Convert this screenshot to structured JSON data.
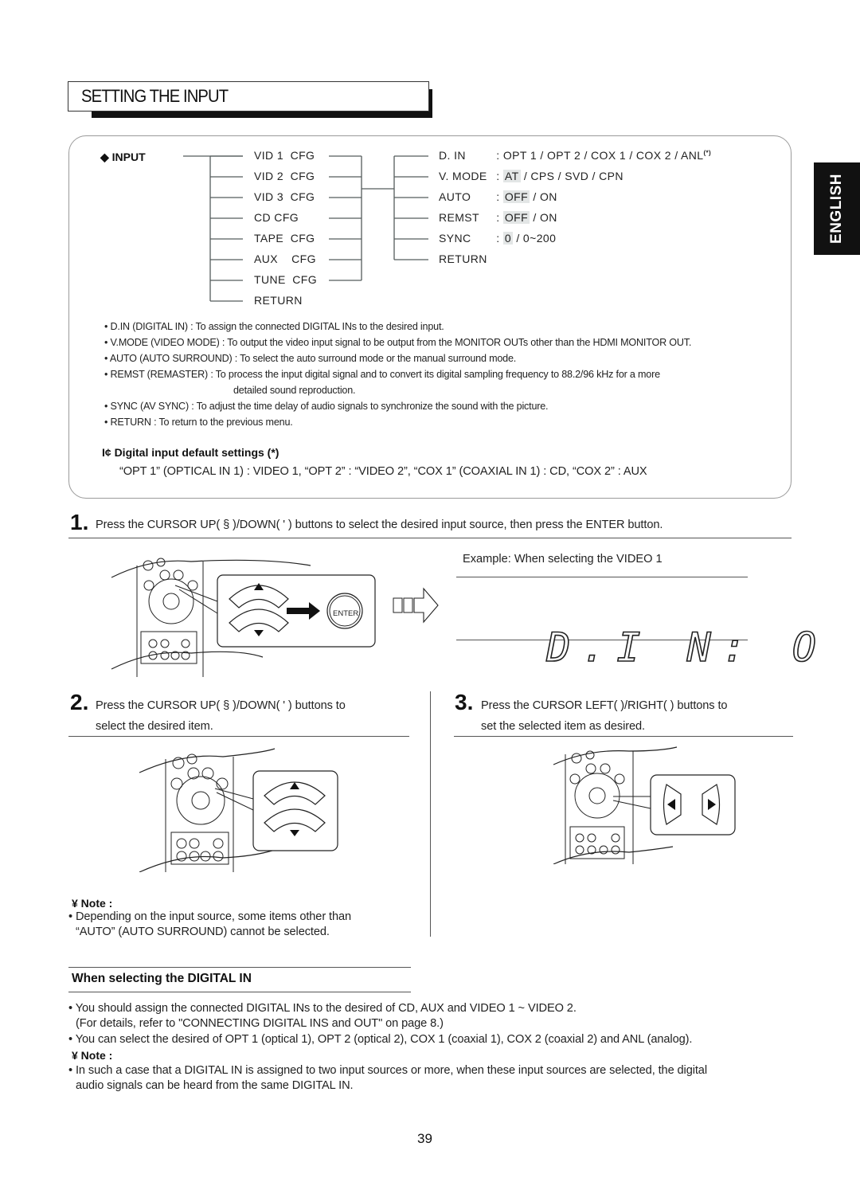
{
  "title": "SETTING THE INPUT",
  "language_tab": "ENGLISH",
  "menu": {
    "root_label": "INPUT",
    "root_bullet": "◆",
    "sub_items": [
      "VID 1  CFG",
      "VID 2  CFG",
      "VID 3  CFG",
      "CD CFG",
      "TAPE  CFG",
      "AUX    CFG",
      "TUNE  CFG",
      "RETURN"
    ],
    "options": [
      {
        "name": "D. IN",
        "sep": " : ",
        "selected": "",
        "rest": "OPT 1 / OPT 2 / COX 1 / COX 2 / ANL",
        "sup": "(*)"
      },
      {
        "name": "V. MODE",
        "sep": " : ",
        "selected": "AT",
        "rest": " / CPS / SVD / CPN",
        "sup": ""
      },
      {
        "name": "AUTO",
        "sep": " : ",
        "selected": "OFF",
        "rest": " / ON",
        "sup": ""
      },
      {
        "name": "REMST",
        "sep": " : ",
        "selected": "OFF",
        "rest": " / ON",
        "sup": ""
      },
      {
        "name": "SYNC",
        "sep": " : ",
        "selected": "0",
        "rest": " / 0~200",
        "sup": ""
      },
      {
        "name": "RETURN",
        "sep": "",
        "selected": "",
        "rest": "",
        "sup": ""
      }
    ]
  },
  "descriptions": [
    "• D.IN (DIGITAL IN) : To assign the connected DIGITAL INs to the desired input.",
    "• V.MODE (VIDEO MODE) : To output the video input signal to be output from the MONITOR OUTs other than the HDMI MONITOR OUT.",
    "• AUTO (AUTO SURROUND) : To select the auto surround mode or the manual surround mode.",
    "• REMST (REMASTER) : To process the input digital signal and to convert its digital sampling frequency to 88.2/96 kHz for a more",
    "detailed sound reproduction.",
    "• SYNC (AV SYNC) : To adjust the time delay of audio signals to synchronize the sound with the picture.",
    "• RETURN : To return to the previous menu."
  ],
  "defaults": {
    "heading": "I¢ Digital input default settings (*)",
    "body": "“OPT 1” (OPTICAL IN 1) : VIDEO 1, “OPT 2” : “VIDEO 2”, “COX 1” (COAXIAL IN 1) : CD, “COX 2” : AUX"
  },
  "steps": [
    {
      "num": "1.",
      "lines": [
        "Press the CURSOR UP( § )/DOWN( ' ) buttons to select the desired input source, then press the ENTER button."
      ]
    },
    {
      "num": "2.",
      "lines": [
        "Press the CURSOR UP( § )/DOWN( ' ) buttons to",
        "select the desired item."
      ]
    },
    {
      "num": "3.",
      "lines": [
        "Press the CURSOR LEFT(    )/RIGHT(    ) buttons to",
        "set the selected item as desired."
      ]
    }
  ],
  "illustration": {
    "enter_label": "ENTER",
    "example_caption": "Example: When selecting the VIDEO 1",
    "display_text": "D.I N: O P T I"
  },
  "note1": {
    "heading": "¥ Note :",
    "lines": [
      "• Depending on the input source, some items other than",
      "“AUTO” (AUTO SURROUND) cannot be selected."
    ]
  },
  "digital_in": {
    "heading": "When selecting the DIGITAL IN",
    "lines": [
      "• You should assign the connected DIGITAL INs to the desired of CD, AUX and VIDEO 1 ~ VIDEO 2.",
      "(For details, refer to \"CONNECTING DIGITAL INS and OUT\" on page 8.)",
      "• You can select the desired of OPT 1 (optical 1), OPT 2 (optical 2), COX 1 (coaxial 1), COX 2 (coaxial 2) and ANL (analog)."
    ],
    "note_heading": "¥ Note :",
    "note_lines": [
      "• In such a case that a DIGITAL IN is assigned to two input sources or more, when these input sources are selected, the digital",
      "audio signals can be heard from the same DIGITAL IN."
    ]
  },
  "page_number": "39"
}
